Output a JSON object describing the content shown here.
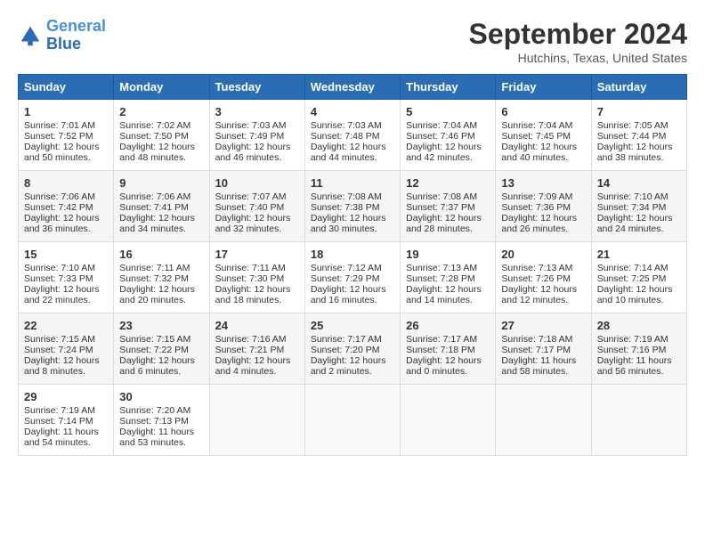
{
  "header": {
    "logo_line1": "General",
    "logo_line2": "Blue",
    "title": "September 2024",
    "subtitle": "Hutchins, Texas, United States"
  },
  "columns": [
    "Sunday",
    "Monday",
    "Tuesday",
    "Wednesday",
    "Thursday",
    "Friday",
    "Saturday"
  ],
  "weeks": [
    [
      {
        "day": "1",
        "lines": [
          "Sunrise: 7:01 AM",
          "Sunset: 7:52 PM",
          "Daylight: 12 hours",
          "and 50 minutes."
        ]
      },
      {
        "day": "2",
        "lines": [
          "Sunrise: 7:02 AM",
          "Sunset: 7:50 PM",
          "Daylight: 12 hours",
          "and 48 minutes."
        ]
      },
      {
        "day": "3",
        "lines": [
          "Sunrise: 7:03 AM",
          "Sunset: 7:49 PM",
          "Daylight: 12 hours",
          "and 46 minutes."
        ]
      },
      {
        "day": "4",
        "lines": [
          "Sunrise: 7:03 AM",
          "Sunset: 7:48 PM",
          "Daylight: 12 hours",
          "and 44 minutes."
        ]
      },
      {
        "day": "5",
        "lines": [
          "Sunrise: 7:04 AM",
          "Sunset: 7:46 PM",
          "Daylight: 12 hours",
          "and 42 minutes."
        ]
      },
      {
        "day": "6",
        "lines": [
          "Sunrise: 7:04 AM",
          "Sunset: 7:45 PM",
          "Daylight: 12 hours",
          "and 40 minutes."
        ]
      },
      {
        "day": "7",
        "lines": [
          "Sunrise: 7:05 AM",
          "Sunset: 7:44 PM",
          "Daylight: 12 hours",
          "and 38 minutes."
        ]
      }
    ],
    [
      {
        "day": "8",
        "lines": [
          "Sunrise: 7:06 AM",
          "Sunset: 7:42 PM",
          "Daylight: 12 hours",
          "and 36 minutes."
        ]
      },
      {
        "day": "9",
        "lines": [
          "Sunrise: 7:06 AM",
          "Sunset: 7:41 PM",
          "Daylight: 12 hours",
          "and 34 minutes."
        ]
      },
      {
        "day": "10",
        "lines": [
          "Sunrise: 7:07 AM",
          "Sunset: 7:40 PM",
          "Daylight: 12 hours",
          "and 32 minutes."
        ]
      },
      {
        "day": "11",
        "lines": [
          "Sunrise: 7:08 AM",
          "Sunset: 7:38 PM",
          "Daylight: 12 hours",
          "and 30 minutes."
        ]
      },
      {
        "day": "12",
        "lines": [
          "Sunrise: 7:08 AM",
          "Sunset: 7:37 PM",
          "Daylight: 12 hours",
          "and 28 minutes."
        ]
      },
      {
        "day": "13",
        "lines": [
          "Sunrise: 7:09 AM",
          "Sunset: 7:36 PM",
          "Daylight: 12 hours",
          "and 26 minutes."
        ]
      },
      {
        "day": "14",
        "lines": [
          "Sunrise: 7:10 AM",
          "Sunset: 7:34 PM",
          "Daylight: 12 hours",
          "and 24 minutes."
        ]
      }
    ],
    [
      {
        "day": "15",
        "lines": [
          "Sunrise: 7:10 AM",
          "Sunset: 7:33 PM",
          "Daylight: 12 hours",
          "and 22 minutes."
        ]
      },
      {
        "day": "16",
        "lines": [
          "Sunrise: 7:11 AM",
          "Sunset: 7:32 PM",
          "Daylight: 12 hours",
          "and 20 minutes."
        ]
      },
      {
        "day": "17",
        "lines": [
          "Sunrise: 7:11 AM",
          "Sunset: 7:30 PM",
          "Daylight: 12 hours",
          "and 18 minutes."
        ]
      },
      {
        "day": "18",
        "lines": [
          "Sunrise: 7:12 AM",
          "Sunset: 7:29 PM",
          "Daylight: 12 hours",
          "and 16 minutes."
        ]
      },
      {
        "day": "19",
        "lines": [
          "Sunrise: 7:13 AM",
          "Sunset: 7:28 PM",
          "Daylight: 12 hours",
          "and 14 minutes."
        ]
      },
      {
        "day": "20",
        "lines": [
          "Sunrise: 7:13 AM",
          "Sunset: 7:26 PM",
          "Daylight: 12 hours",
          "and 12 minutes."
        ]
      },
      {
        "day": "21",
        "lines": [
          "Sunrise: 7:14 AM",
          "Sunset: 7:25 PM",
          "Daylight: 12 hours",
          "and 10 minutes."
        ]
      }
    ],
    [
      {
        "day": "22",
        "lines": [
          "Sunrise: 7:15 AM",
          "Sunset: 7:24 PM",
          "Daylight: 12 hours",
          "and 8 minutes."
        ]
      },
      {
        "day": "23",
        "lines": [
          "Sunrise: 7:15 AM",
          "Sunset: 7:22 PM",
          "Daylight: 12 hours",
          "and 6 minutes."
        ]
      },
      {
        "day": "24",
        "lines": [
          "Sunrise: 7:16 AM",
          "Sunset: 7:21 PM",
          "Daylight: 12 hours",
          "and 4 minutes."
        ]
      },
      {
        "day": "25",
        "lines": [
          "Sunrise: 7:17 AM",
          "Sunset: 7:20 PM",
          "Daylight: 12 hours",
          "and 2 minutes."
        ]
      },
      {
        "day": "26",
        "lines": [
          "Sunrise: 7:17 AM",
          "Sunset: 7:18 PM",
          "Daylight: 12 hours",
          "and 0 minutes."
        ]
      },
      {
        "day": "27",
        "lines": [
          "Sunrise: 7:18 AM",
          "Sunset: 7:17 PM",
          "Daylight: 11 hours",
          "and 58 minutes."
        ]
      },
      {
        "day": "28",
        "lines": [
          "Sunrise: 7:19 AM",
          "Sunset: 7:16 PM",
          "Daylight: 11 hours",
          "and 56 minutes."
        ]
      }
    ],
    [
      {
        "day": "29",
        "lines": [
          "Sunrise: 7:19 AM",
          "Sunset: 7:14 PM",
          "Daylight: 11 hours",
          "and 54 minutes."
        ]
      },
      {
        "day": "30",
        "lines": [
          "Sunrise: 7:20 AM",
          "Sunset: 7:13 PM",
          "Daylight: 11 hours",
          "and 53 minutes."
        ]
      },
      {
        "day": "",
        "lines": []
      },
      {
        "day": "",
        "lines": []
      },
      {
        "day": "",
        "lines": []
      },
      {
        "day": "",
        "lines": []
      },
      {
        "day": "",
        "lines": []
      }
    ]
  ]
}
